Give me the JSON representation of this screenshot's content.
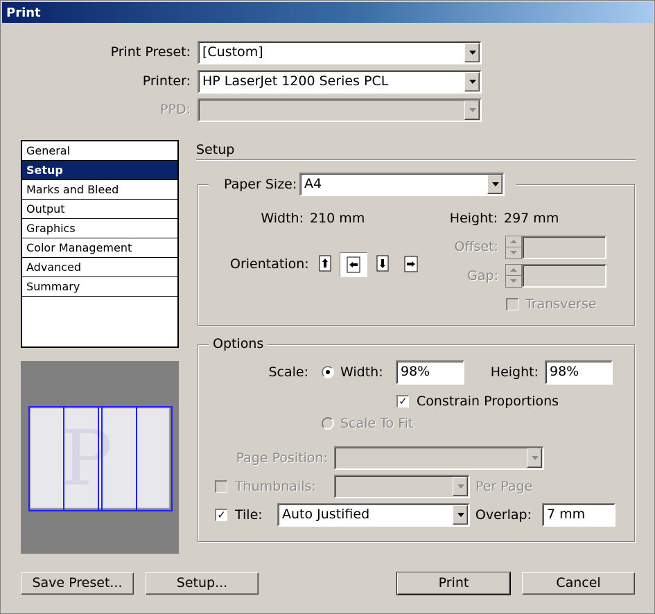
{
  "title": "Print",
  "print_preset": {
    "label": "Print Preset:",
    "value": "[Custom]"
  },
  "printer": {
    "label": "Printer:",
    "value": "HP LaserJet 1200 Series PCL"
  },
  "ppd": {
    "label": "PPD:",
    "value": ""
  },
  "sidebar": {
    "items": [
      {
        "label": "General"
      },
      {
        "label": "Setup"
      },
      {
        "label": "Marks and Bleed"
      },
      {
        "label": "Output"
      },
      {
        "label": "Graphics"
      },
      {
        "label": "Color Management"
      },
      {
        "label": "Advanced"
      },
      {
        "label": "Summary"
      }
    ],
    "selected": "Setup"
  },
  "setup": {
    "heading": "Setup",
    "paper_size": {
      "label": "Paper Size:",
      "value": "A4"
    },
    "width": {
      "label": "Width:",
      "value": "210 mm"
    },
    "height": {
      "label": "Height:",
      "value": "297 mm"
    },
    "orientation_label": "Orientation:",
    "offset_label": "Offset:",
    "gap_label": "Gap:",
    "transverse_label": "Transverse"
  },
  "options": {
    "heading": "Options",
    "scale_label": "Scale:",
    "width_label": "Width:",
    "width_value": "98%",
    "height_label": "Height:",
    "height_value": "98%",
    "constrain_label": "Constrain Proportions",
    "constrain_checked": true,
    "scale_to_fit_label": "Scale To Fit",
    "page_position_label": "Page Position:",
    "thumbnails_label": "Thumbnails:",
    "per_page_label": "Per Page",
    "tile_label": "Tile:",
    "tile_checked": true,
    "tile_value": "Auto Justified",
    "overlap_label": "Overlap:",
    "overlap_value": "7 mm"
  },
  "buttons": {
    "save_preset": "Save Preset...",
    "setup": "Setup...",
    "print": "Print",
    "cancel": "Cancel"
  },
  "colors": {
    "title_start": "#0a246a",
    "title_end": "#a6caf0",
    "selection": "#0a246a",
    "preview_outline": "#2020ff"
  }
}
